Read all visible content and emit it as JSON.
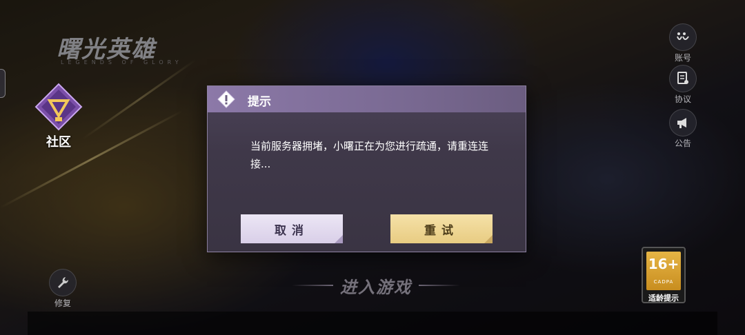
{
  "app": {
    "logo_title": "曙光英雄",
    "logo_subtitle": "LEGENDS OF GLORY"
  },
  "left_panel": {
    "community_label": "社区",
    "repair_label": "修复"
  },
  "right_panel": {
    "items": [
      {
        "label": "账号",
        "icon": "account-icon"
      },
      {
        "label": "协议",
        "icon": "agreement-icon"
      },
      {
        "label": "公告",
        "icon": "announcement-icon"
      }
    ]
  },
  "age_rating": {
    "number": "16+",
    "org": "CADPA",
    "label": "适龄提示"
  },
  "enter_game": {
    "label": "进入游戏"
  },
  "dialog": {
    "title": "提示",
    "message": "当前服务器拥堵，小曙正在为您进行疏通，请重连连接...",
    "cancel_label": "取消",
    "retry_label": "重试"
  },
  "colors": {
    "dialog_header": "#8c79a8",
    "dialog_body": "#3f3849",
    "cancel_button": "#e5ddf0",
    "retry_button": "#f0d894",
    "age_badge": "#d9a133"
  }
}
